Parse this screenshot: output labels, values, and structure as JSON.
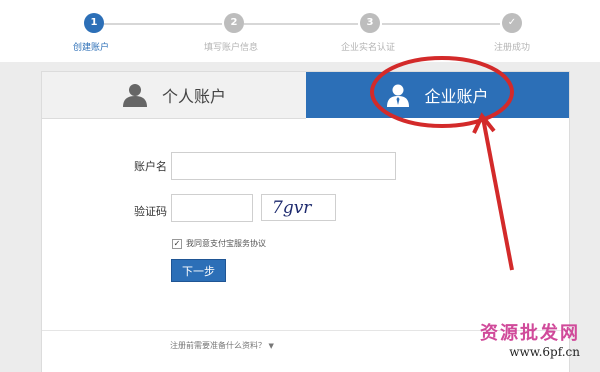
{
  "steps": [
    {
      "number": "1",
      "label": "创建账户",
      "active": true
    },
    {
      "number": "2",
      "label": "填写账户信息",
      "active": false
    },
    {
      "number": "3",
      "label": "企业实名认证",
      "active": false
    },
    {
      "number": "✓",
      "label": "注册成功",
      "active": false
    }
  ],
  "tabs": {
    "personal": "个人账户",
    "enterprise": "企业账户"
  },
  "form": {
    "account_label": "账户名",
    "account_value": "",
    "captcha_label": "验证码",
    "captcha_value": "",
    "captcha_image_text": "7gvr",
    "agree_prefix": "我同意",
    "agree_link": "支付宝服务协议",
    "next_button": "下一步"
  },
  "footer": {
    "link": "注册前需要准备什么资料？"
  },
  "watermark": {
    "title": "资源批发网",
    "url": "www.6pf.cn"
  },
  "colors": {
    "accent": "#2c6fb7",
    "annotation": "#d32a2a"
  }
}
